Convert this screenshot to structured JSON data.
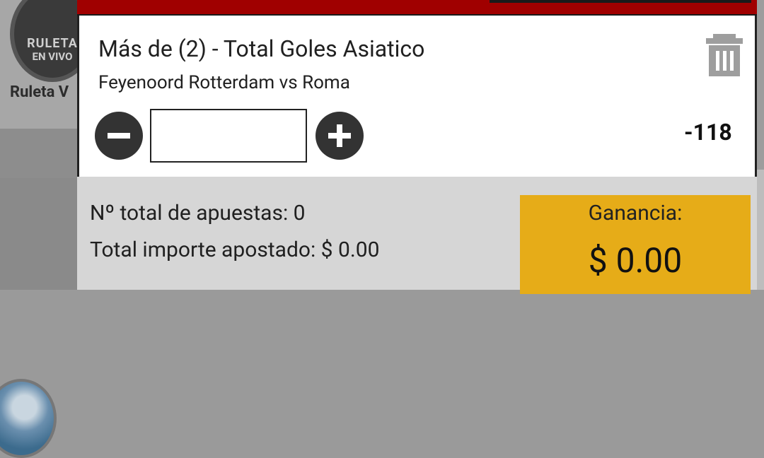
{
  "background": {
    "roulette_logo_line1": "RULETA",
    "roulette_logo_line2": "EN VIVO",
    "roulette_label": "Ruleta V"
  },
  "betslip": {
    "market_title": "Más de (2) - Total Goles Asiatico",
    "event_name": "Feyenoord Rotterdam vs Roma",
    "stake_value": "",
    "stake_placeholder": "",
    "odds": "-118",
    "total_bets": "Nº total de apuestas: 0",
    "total_stake": "Total importe apostado: $ 0.00",
    "winnings_label": "Ganancia:",
    "winnings_amount": "$ 0.00"
  },
  "icons": {
    "delete": "trash-icon",
    "decrease": "minus-icon",
    "increase": "plus-icon"
  },
  "colors": {
    "topbar": "#a00000",
    "winnings_box": "#e6ac18",
    "summary_bg": "#d6d6d6",
    "stepper": "#333333"
  }
}
